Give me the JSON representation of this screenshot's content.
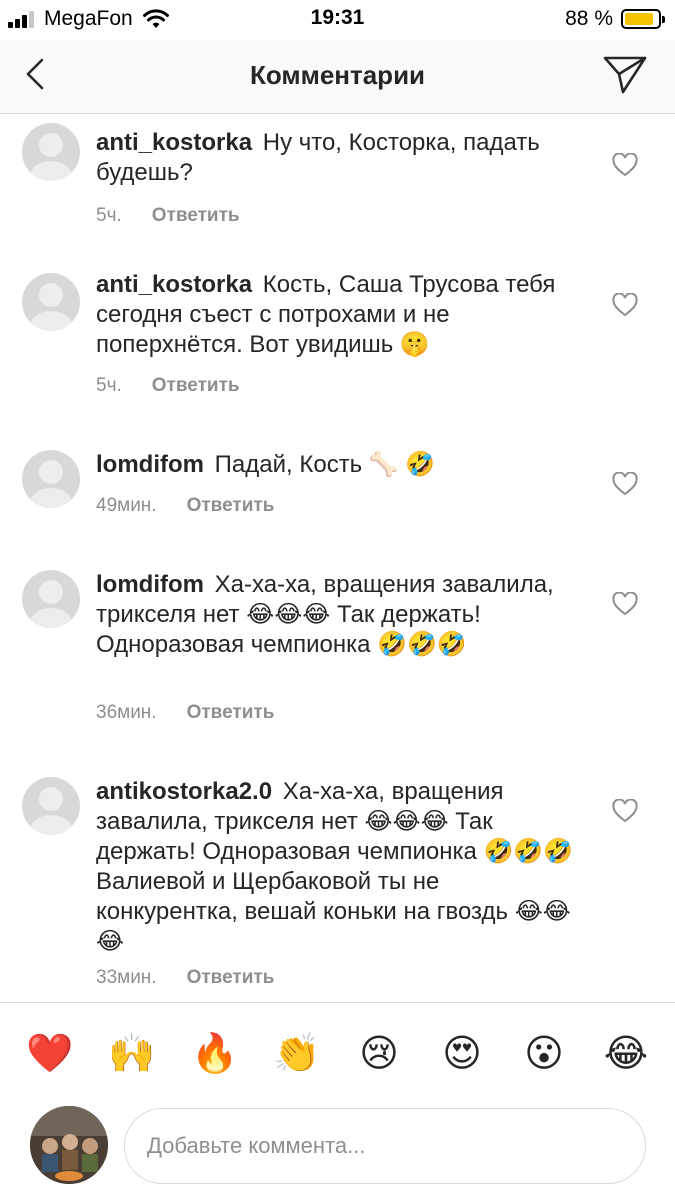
{
  "status_bar": {
    "carrier": "MegaFon",
    "time": "19:31",
    "battery_percent": "88 %",
    "battery_level": 0.88,
    "signal_bars_filled": 3,
    "signal_bars_total": 4
  },
  "header": {
    "title": "Комментарии",
    "back_icon": "chevron-left-icon",
    "send_icon": "paper-plane-icon"
  },
  "comments": [
    {
      "username": "anti_kostorka",
      "text": "Ну что, Косторка, падать будешь?",
      "time": "5ч.",
      "reply_label": "Ответить"
    },
    {
      "username": "anti_kostorka",
      "text": "Кость, Саша Трусова тебя сегодня съест с потрохами и не поперхнётся. Вот увидишь 🤫",
      "time": "5ч.",
      "reply_label": "Ответить"
    },
    {
      "username": "lomdifom",
      "text": "Падай, Кость 🦴 🤣",
      "time": "49мин.",
      "reply_label": "Ответить"
    },
    {
      "username": "lomdifom",
      "text": "Ха-ха-ха, вращения завалила, трикселя нет 😂😂😂 Так держать! Одноразовая чемпионка 🤣🤣🤣",
      "time": "36мин.",
      "reply_label": "Ответить"
    },
    {
      "username": "antikostorka2.0",
      "text": "Ха-ха-ха, вращения завалила, трикселя нет 😂😂😂 Так держать! Одноразовая чемпионка 🤣🤣🤣 Валиевой и Щербаковой ты не конкурентка, вешай коньки на гвоздь 😂😂😂",
      "time": "33мин.",
      "reply_label": "Ответить"
    }
  ],
  "emoji_bar": [
    {
      "glyph": "❤️",
      "name": "red-heart-emoji"
    },
    {
      "glyph": "🙌",
      "name": "raising-hands-emoji"
    },
    {
      "glyph": "🔥",
      "name": "fire-emoji"
    },
    {
      "glyph": "👏",
      "name": "clapping-hands-emoji"
    },
    {
      "glyph": "😢",
      "name": "crying-face-emoji"
    },
    {
      "glyph": "😍",
      "name": "heart-eyes-emoji"
    },
    {
      "glyph": "😮",
      "name": "open-mouth-emoji"
    },
    {
      "glyph": "😂",
      "name": "tears-of-joy-emoji"
    }
  ],
  "composer": {
    "placeholder": "Добавьте коммента..."
  },
  "colors": {
    "text": "#262626",
    "secondary_text": "#8e8e8e",
    "divider": "#dbdbdb",
    "header_bg": "#fafafa",
    "battery": "#f5c400"
  }
}
